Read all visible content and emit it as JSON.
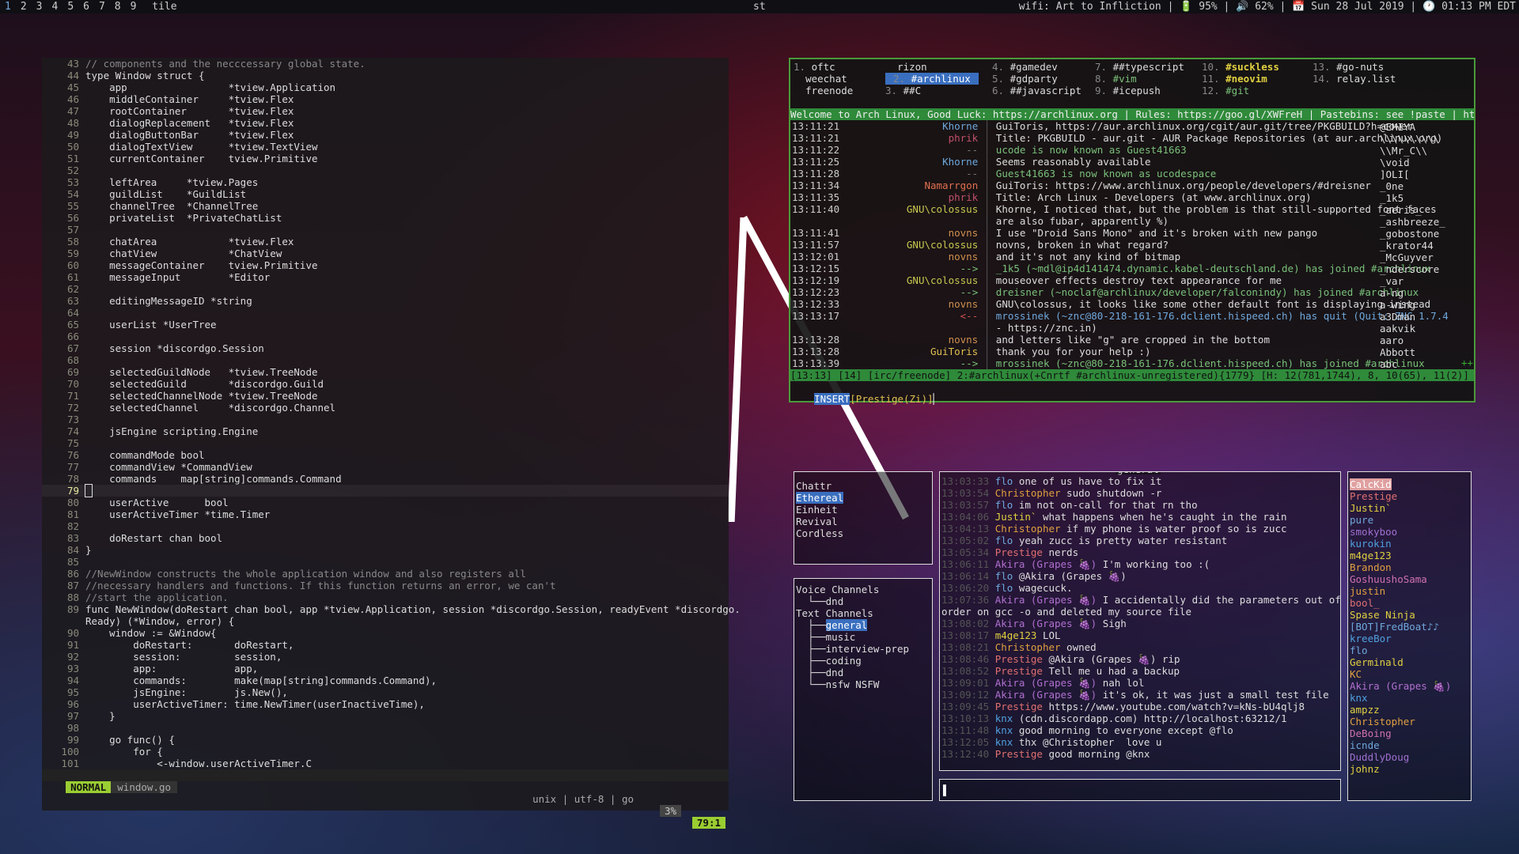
{
  "topbar": {
    "workspaces": [
      "1",
      "2",
      "3",
      "4",
      "5",
      "6",
      "7",
      "8",
      "9"
    ],
    "layout": "tile",
    "title": "st",
    "status": "wifi: Art to Infliction | 🔋 95% | 🔊 62% | 📅 Sun 28 Jul 2019 | 🕐 01:13 PM EDT"
  },
  "editor": {
    "lines": [
      [
        "43",
        "// components and the necccessary global state."
      ],
      [
        "44",
        "type Window struct {"
      ],
      [
        "45",
        "    app                 *tview.Application"
      ],
      [
        "46",
        "    middleContainer     *tview.Flex"
      ],
      [
        "47",
        "    rootContainer       *tview.Flex"
      ],
      [
        "48",
        "    dialogReplacement   *tview.Flex"
      ],
      [
        "49",
        "    dialogButtonBar     *tview.Flex"
      ],
      [
        "50",
        "    dialogTextView      *tview.TextView"
      ],
      [
        "51",
        "    currentContainer    tview.Primitive"
      ],
      [
        "52",
        ""
      ],
      [
        "53",
        "    leftArea     *tview.Pages"
      ],
      [
        "54",
        "    guildList    *GuildList"
      ],
      [
        "55",
        "    channelTree  *ChannelTree"
      ],
      [
        "56",
        "    privateList  *PrivateChatList"
      ],
      [
        "57",
        ""
      ],
      [
        "58",
        "    chatArea            *tview.Flex"
      ],
      [
        "59",
        "    chatView            *ChatView"
      ],
      [
        "60",
        "    messageContainer    tview.Primitive"
      ],
      [
        "61",
        "    messageInput        *Editor"
      ],
      [
        "62",
        ""
      ],
      [
        "63",
        "    editingMessageID *string"
      ],
      [
        "64",
        ""
      ],
      [
        "65",
        "    userList *UserTree"
      ],
      [
        "66",
        ""
      ],
      [
        "67",
        "    session *discordgo.Session"
      ],
      [
        "68",
        ""
      ],
      [
        "69",
        "    selectedGuildNode   *tview.TreeNode"
      ],
      [
        "70",
        "    selectedGuild       *discordgo.Guild"
      ],
      [
        "71",
        "    selectedChannelNode *tview.TreeNode"
      ],
      [
        "72",
        "    selectedChannel     *discordgo.Channel"
      ],
      [
        "73",
        ""
      ],
      [
        "74",
        "    jsEngine scripting.Engine"
      ],
      [
        "75",
        ""
      ],
      [
        "76",
        "    commandMode bool"
      ],
      [
        "77",
        "    commandView *CommandView"
      ],
      [
        "78",
        "    commands    map[string]commands.Command"
      ],
      [
        "79",
        ""
      ],
      [
        "80",
        "    userActive      bool"
      ],
      [
        "81",
        "    userActiveTimer *time.Timer"
      ],
      [
        "82",
        ""
      ],
      [
        "83",
        "    doRestart chan bool"
      ],
      [
        "84",
        "}"
      ],
      [
        "85",
        ""
      ],
      [
        "86",
        "//NewWindow constructs the whole application window and also registers all"
      ],
      [
        "87",
        "//necessary handlers and functions. If this function returns an error, we can't"
      ],
      [
        "88",
        "//start the application."
      ],
      [
        "89",
        "func NewWindow(doRestart chan bool, app *tview.Application, session *discordgo.Session, readyEvent *discordgo."
      ],
      [
        "",
        "Ready) (*Window, error) {"
      ],
      [
        "90",
        "    window := &Window{"
      ],
      [
        "91",
        "        doRestart:       doRestart,"
      ],
      [
        "92",
        "        session:         session,"
      ],
      [
        "93",
        "        app:             app,"
      ],
      [
        "94",
        "        commands:        make(map[string]commands.Command),"
      ],
      [
        "95",
        "        jsEngine:        js.New(),"
      ],
      [
        "96",
        "        userActiveTimer: time.NewTimer(userInactiveTime),"
      ],
      [
        "97",
        "    }"
      ],
      [
        "98",
        ""
      ],
      [
        "99",
        "    go func() {"
      ],
      [
        "100",
        "        for {"
      ],
      [
        "101",
        "            <-window.userActiveTimer.C"
      ]
    ],
    "status": {
      "mode": "NORMAL",
      "file": "window.go",
      "info": "unix | utf-8 | go",
      "percent": "3%",
      "position": "79:1"
    }
  },
  "weechat": {
    "buffers": [
      {
        "n": "1.",
        "name": "oftc"
      },
      {
        "n": "",
        "name": "rizon"
      },
      {
        "n": "4.",
        "name": "#gamedev"
      },
      {
        "n": "7.",
        "name": "##typescript"
      },
      {
        "n": "10.",
        "name": "#suckless"
      },
      {
        "n": "13.",
        "name": "#go-nuts"
      },
      {
        "n": "",
        "name": "weechat"
      },
      {
        "n": "2.",
        "name": "#archlinux"
      },
      {
        "n": "5.",
        "name": "#gdparty"
      },
      {
        "n": "8.",
        "name": "#vim"
      },
      {
        "n": "11.",
        "name": "#neovim"
      },
      {
        "n": "14.",
        "name": "relay.list"
      },
      {
        "n": "",
        "name": "freenode"
      },
      {
        "n": "3.",
        "name": "##C"
      },
      {
        "n": "6.",
        "name": "##javascript"
      },
      {
        "n": "9.",
        "name": "#icepush"
      },
      {
        "n": "12.",
        "name": "#git"
      }
    ],
    "topic": "Welcome to Arch Linux, Good Luck: https://archlinux.org | Rules: https://goo.gl/XWFreH | Pastebins: see !paste | https://>",
    "lines": [
      {
        "t": "13:11:21",
        "nick": "Khorne",
        "c": "#6fa8dc",
        "msg": "GuiToris, https://aur.archlinux.org/cgit/aur.git/tree/PKGBUILD?h=cower"
      },
      {
        "t": "13:11:21",
        "nick": "phrik",
        "c": "#c0506a",
        "msg": "Title: PKGBUILD - aur.git - AUR Package Repositories (at aur.archlinux.org)"
      },
      {
        "t": "13:11:22",
        "nick": "--",
        "c": "#777",
        "msg": "ucode is now known as Guest41663"
      },
      {
        "t": "13:11:25",
        "nick": "Khorne",
        "c": "#6fa8dc",
        "msg": "Seems reasonably available"
      },
      {
        "t": "13:11:28",
        "nick": "--",
        "c": "#777",
        "msg": "Guest41663 is now known as ucodespace"
      },
      {
        "t": "13:11:34",
        "nick": "Namarrgon",
        "c": "#e07050",
        "msg": "GuiToris: https://www.archlinux.org/people/developers/#dreisner"
      },
      {
        "t": "13:11:35",
        "nick": "phrik",
        "c": "#c0506a",
        "msg": "Title: Arch Linux - Developers (at www.archlinux.org)"
      },
      {
        "t": "13:11:40",
        "nick": "GNU\\colossus",
        "c": "#c8c850",
        "msg": "Khorne, I noticed that, but the problem is that still-supported font faces"
      },
      {
        "t": "",
        "nick": "",
        "c": "#ccc",
        "msg": "are also fubar, apparently %)"
      },
      {
        "t": "13:11:41",
        "nick": "novns",
        "c": "#d09050",
        "msg": "I use \"Droid Sans Mono\" and it's broken with new pango"
      },
      {
        "t": "13:11:57",
        "nick": "GNU\\colossus",
        "c": "#c8c850",
        "msg": "novns, broken in what regard?"
      },
      {
        "t": "13:12:01",
        "nick": "novns",
        "c": "#d09050",
        "msg": "and it's not any kind of bitmap"
      },
      {
        "t": "13:12:15",
        "nick": "-->",
        "c": "#7ac07a",
        "msg": "_1k5 (~mdl@ip4d141474.dynamic.kabel-deutschland.de) has joined #archlinux"
      },
      {
        "t": "13:12:19",
        "nick": "GNU\\colossus",
        "c": "#c8c850",
        "msg": "mouseover effects destroy text appearance for me"
      },
      {
        "t": "13:12:23",
        "nick": "-->",
        "c": "#7ac07a",
        "msg": "dreisner (~noclaf@archlinux/developer/falconindy) has joined #archlinux"
      },
      {
        "t": "13:12:33",
        "nick": "novns",
        "c": "#d09050",
        "msg": "GNU\\colossus, it looks like some other default font is displaying instead"
      },
      {
        "t": "13:13:17",
        "nick": "<--",
        "c": "#d05050",
        "msg": "mrossinek (~znc@80-218-161-176.dclient.hispeed.ch) has quit (Quit: ZNC 1.7.4"
      },
      {
        "t": "",
        "nick": "",
        "c": "#ccc",
        "msg": "- https://znc.in)"
      },
      {
        "t": "13:13:28",
        "nick": "novns",
        "c": "#d09050",
        "msg": "and letters like \"g\" are cropped in the bottom"
      },
      {
        "t": "13:13:28",
        "nick": "GuiToris",
        "c": "#e0c050",
        "msg": "thank you for your help :)"
      },
      {
        "t": "13:13:39",
        "nick": "-->",
        "c": "#7ac07a",
        "msg": "mrossinek (~znc@80-218-161-176.dclient.hispeed.ch) has joined #archlinux"
      }
    ],
    "nicklist": [
      "@EMIYA",
      "\\\\\\\\\\\\\\\\\\\\",
      "\\\\Mr_C\\\\",
      "\\void",
      "]OLI[",
      "_0ne",
      "_1k5",
      "_aeris_",
      "_ashbreeze_",
      "_gobostone",
      "_krator44",
      "_McGuyver",
      "_nderscore",
      "_var",
      "a-ng",
      "a-wing",
      "a3Dman",
      "aakvik",
      "aaro",
      "Abbott",
      "abc"
    ],
    "more": "++",
    "status": "[13:13] [14] [irc/freenode] 2:#archlinux(+Cnrtf #archlinux-unregistered){1779} [H: 12(781,1744), 8, 10(65), 11(2)]",
    "input_mode": "INSERT",
    "input_nick": "[Prestige(Zi)]"
  },
  "cordless": {
    "guilds": [
      "Chattr",
      "Ethereal",
      "Einheit",
      "Revival",
      "Cordless"
    ],
    "selected_guild": "Ethereal",
    "channels_title": "general",
    "tree": [
      "Voice Channels",
      "└──dnd",
      "Text Channels",
      "├──general",
      "├──music",
      "├──interview-prep",
      "├──coding",
      "├──dnd",
      "└──nsfw NSFW"
    ],
    "selected_channel": "general",
    "messages": [
      {
        "ts": "13:03:33",
        "nick": "flo",
        "c": "#6fa8dc",
        "msg": "one of us have to fix it"
      },
      {
        "ts": "13:03:54",
        "nick": "Christopher",
        "c": "#e0a040",
        "msg": "sudo shutdown -r"
      },
      {
        "ts": "13:03:57",
        "nick": "flo",
        "c": "#6fa8dc",
        "msg": "im not on-call for that rn tho"
      },
      {
        "ts": "13:04:06",
        "nick": "Justin`",
        "c": "#e0d040",
        "msg": "what happens when he's caught in the rain"
      },
      {
        "ts": "13:04:13",
        "nick": "Christopher",
        "c": "#e0a040",
        "msg": "if my phone is water proof so is zucc"
      },
      {
        "ts": "13:05:02",
        "nick": "flo",
        "c": "#6fa8dc",
        "msg": "yeah zucc is pretty water resistant"
      },
      {
        "ts": "13:05:34",
        "nick": "Prestige",
        "c": "#e07070",
        "msg": "nerds"
      },
      {
        "ts": "13:06:11",
        "nick": "Akira (Grapes 🍇)",
        "c": "#b070d0",
        "msg": "I'm working too :("
      },
      {
        "ts": "13:06:14",
        "nick": "flo",
        "c": "#6fa8dc",
        "msg": "@Akira (Grapes 🍇)"
      },
      {
        "ts": "13:06:20",
        "nick": "flo",
        "c": "#6fa8dc",
        "msg": "wagecuck."
      },
      {
        "ts": "13:07:36",
        "nick": "Akira (Grapes 🍇)",
        "c": "#b070d0",
        "msg": "I accidentally did the parameters out of"
      },
      {
        "ts": "",
        "nick": "",
        "c": "#ccc",
        "msg": "order on gcc -o and deleted my source file"
      },
      {
        "ts": "13:08:02",
        "nick": "Akira (Grapes 🍇)",
        "c": "#b070d0",
        "msg": "Sigh"
      },
      {
        "ts": "13:08:17",
        "nick": "m4ge123",
        "c": "#e0d040",
        "msg": "LOL"
      },
      {
        "ts": "13:08:21",
        "nick": "Christopher",
        "c": "#e0a040",
        "msg": "owned"
      },
      {
        "ts": "13:08:46",
        "nick": "Prestige",
        "c": "#e07070",
        "msg": "@Akira (Grapes 🍇) rip"
      },
      {
        "ts": "13:08:52",
        "nick": "Prestige",
        "c": "#e07070",
        "msg": "Tell me u had a backup"
      },
      {
        "ts": "13:09:01",
        "nick": "Akira (Grapes 🍇)",
        "c": "#b070d0",
        "msg": "nah lol"
      },
      {
        "ts": "13:09:12",
        "nick": "Akira (Grapes 🍇)",
        "c": "#b070d0",
        "msg": "it's ok, it was just a small test file"
      },
      {
        "ts": "13:09:45",
        "nick": "Prestige",
        "c": "#e07070",
        "msg": "https://www.youtube.com/watch?v=kNs-bU4qlj8"
      },
      {
        "ts": "13:10:13",
        "nick": "knx",
        "c": "#50a0e0",
        "msg": "(cdn.discordapp.com) http://localhost:63212/1"
      },
      {
        "ts": "13:11:48",
        "nick": "knx",
        "c": "#50a0e0",
        "msg": "good morning to everyone except @flo"
      },
      {
        "ts": "13:12:05",
        "nick": "knx",
        "c": "#50a0e0",
        "msg": "thx @Christopher  love u"
      },
      {
        "ts": "13:12:40",
        "nick": "Prestige",
        "c": "#e07070",
        "msg": "good morning @knx"
      }
    ],
    "users": [
      {
        "n": "CalcKid",
        "c": "#e07070"
      },
      {
        "n": "Prestige",
        "c": "#e07070"
      },
      {
        "n": "Justin`",
        "c": "#e0d040"
      },
      {
        "n": "pure",
        "c": "#6fa8dc"
      },
      {
        "n": "smokyboo",
        "c": "#a070d0"
      },
      {
        "n": "kurokin",
        "c": "#50a0e0"
      },
      {
        "n": "m4ge123",
        "c": "#e0d040"
      },
      {
        "n": "Brandon",
        "c": "#e0a040"
      },
      {
        "n": "GoshuushoSama",
        "c": "#d070b0"
      },
      {
        "n": "justin",
        "c": "#e0a040"
      },
      {
        "n": "bool_",
        "c": "#e07070"
      },
      {
        "n": "Spase Ninja",
        "c": "#e0d040"
      },
      {
        "n": "[BOT]FredBoat♪♪",
        "c": "#6fa8dc"
      },
      {
        "n": "kreeBor",
        "c": "#50a0e0"
      },
      {
        "n": "flo",
        "c": "#6fa8dc"
      },
      {
        "n": "Germinald",
        "c": "#e0d040"
      },
      {
        "n": "KC",
        "c": "#e0a040"
      },
      {
        "n": "Akira (Grapes 🍇)",
        "c": "#b070d0"
      },
      {
        "n": "knx",
        "c": "#50a0e0"
      },
      {
        "n": "ampzz",
        "c": "#e0d040"
      },
      {
        "n": "Christopher",
        "c": "#e0a040"
      },
      {
        "n": "DeBoing",
        "c": "#d070b0"
      },
      {
        "n": "icnde",
        "c": "#6fa8dc"
      },
      {
        "n": "DuddlyDoug",
        "c": "#a070d0"
      },
      {
        "n": "johnz",
        "c": "#e0d040"
      }
    ]
  }
}
